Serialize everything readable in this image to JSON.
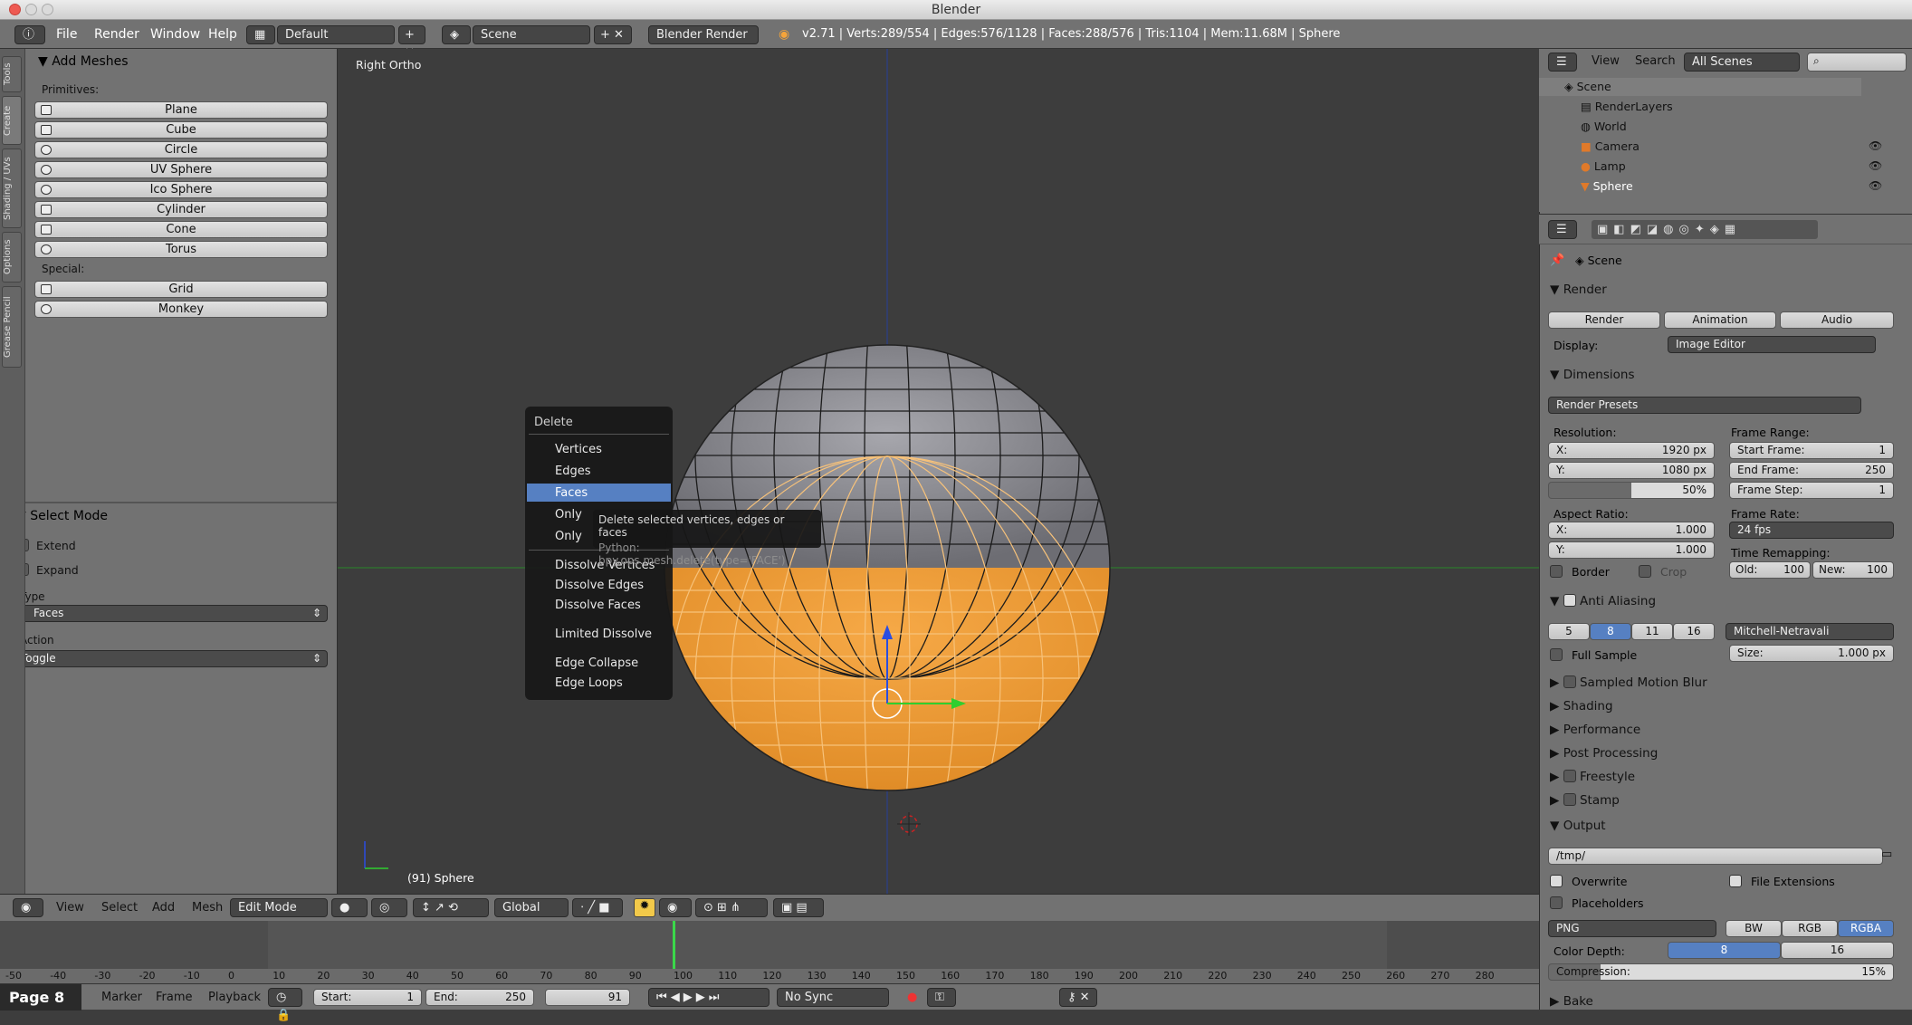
{
  "window": {
    "title": "Blender"
  },
  "infobar": {
    "menus": [
      "File",
      "Render",
      "Window",
      "Help"
    ],
    "layout": "Default",
    "scene": "Scene",
    "engine": "Blender Render",
    "stats": "v2.71 | Verts:289/554 | Edges:576/1128 | Faces:288/576 | Tris:1104 | Mem:11.68M | Sphere"
  },
  "tabs": [
    "Tools",
    "Create",
    "Shading / UVs",
    "Options",
    "Grease Pencil"
  ],
  "add_meshes": {
    "title": "Add Meshes",
    "primitives_label": "Primitives:",
    "primitives": [
      "Plane",
      "Cube",
      "Circle",
      "UV Sphere",
      "Ico Sphere",
      "Cylinder",
      "Cone",
      "Torus"
    ],
    "special_label": "Special:",
    "special": [
      "Grid",
      "Monkey"
    ]
  },
  "select_mode": {
    "title": "Select Mode",
    "extend": "Extend",
    "expand": "Expand",
    "type_label": "Type",
    "type_value": "Faces",
    "action_label": "Action",
    "action_value": "Toggle"
  },
  "viewport": {
    "view_name": "Right Ortho",
    "object_info": "(91) Sphere"
  },
  "delete_menu": {
    "title": "Delete",
    "items": [
      "Vertices",
      "Edges",
      "Faces",
      "Only",
      "Only",
      "Dissolve Vertices",
      "Dissolve Edges",
      "Dissolve Faces",
      "Limited Dissolve",
      "Edge Collapse",
      "Edge Loops"
    ],
    "highlighted": "Faces"
  },
  "tooltip": {
    "line1": "Delete selected vertices, edges or faces",
    "line2": "Python: bpy.ops.mesh.delete(type='FACE')"
  },
  "outliner": {
    "view": "View",
    "search": "Search",
    "filter": "All Scenes",
    "items": [
      "Scene",
      "RenderLayers",
      "World",
      "Camera",
      "Lamp",
      "Sphere"
    ]
  },
  "properties": {
    "scene_label": "Scene",
    "render": {
      "title": "Render",
      "buttons": [
        "Render",
        "Animation",
        "Audio"
      ],
      "display_label": "Display:",
      "display_value": "Image Editor"
    },
    "dimensions": {
      "title": "Dimensions",
      "presets": "Render Presets",
      "resolution_label": "Resolution:",
      "x": "X:",
      "x_val": "1920 px",
      "y": "Y:",
      "y_val": "1080 px",
      "pct": "50%",
      "frame_range_label": "Frame Range:",
      "start": "Start Frame:",
      "start_val": "1",
      "end": "End Frame:",
      "end_val": "250",
      "step": "Frame Step:",
      "step_val": "1",
      "aspect_label": "Aspect Ratio:",
      "ax_val": "1.000",
      "ay_val": "1.000",
      "frame_rate_label": "Frame Rate:",
      "fps": "24 fps",
      "border": "Border",
      "crop": "Crop",
      "time_remap": "Time Remapping:",
      "old": "Old:",
      "old_val": "100",
      "new": "New:",
      "new_val": "100"
    },
    "aa": {
      "title": "Anti Aliasing",
      "samples": [
        "5",
        "8",
        "11",
        "16"
      ],
      "selected": "8",
      "filter": "Mitchell-Netravali",
      "full_sample": "Full Sample",
      "size": "Size:",
      "size_val": "1.000 px"
    },
    "collapsed": [
      "Sampled Motion Blur",
      "Shading",
      "Performance",
      "Post Processing",
      "Freestyle",
      "Stamp"
    ],
    "output": {
      "title": "Output",
      "path": "/tmp/",
      "overwrite": "Overwrite",
      "file_ext": "File Extensions",
      "placeholders": "Placeholders",
      "format": "PNG",
      "modes": [
        "BW",
        "RGB",
        "RGBA"
      ],
      "color_depth": "Color Depth:",
      "depth": [
        "8",
        "16"
      ],
      "compression": "Compression:",
      "compression_val": "15%"
    },
    "bake": "Bake"
  },
  "header3d": {
    "menus": [
      "View",
      "Select",
      "Add",
      "Mesh"
    ],
    "mode": "Edit Mode",
    "orientation": "Global"
  },
  "ruler": {
    "ticks": [
      "-50",
      "-40",
      "-30",
      "-20",
      "-10",
      "0",
      "10",
      "20",
      "30",
      "40",
      "50",
      "60",
      "70",
      "80",
      "90",
      "100",
      "110",
      "120",
      "130",
      "140",
      "150",
      "160",
      "170",
      "180",
      "190",
      "200",
      "210",
      "220",
      "230",
      "240",
      "250",
      "260",
      "270",
      "280"
    ]
  },
  "timeline": {
    "page": "Page 8",
    "menus": [
      "Marker",
      "Frame",
      "Playback"
    ],
    "start_label": "Start:",
    "start": "1",
    "end_label": "End:",
    "end": "250",
    "current": "91",
    "sync": "No Sync"
  },
  "colors": {
    "selected_orange": "#f5a43a",
    "highlight_blue": "#5680c2",
    "panel": "#727272"
  }
}
